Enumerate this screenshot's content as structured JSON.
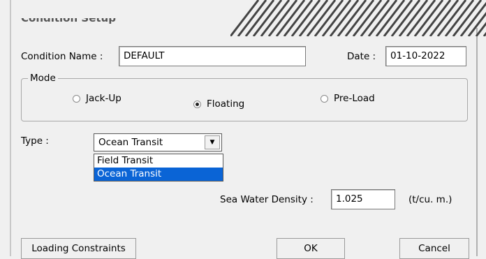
{
  "window": {
    "title": "Condition Setup"
  },
  "condition_name": {
    "label": "Condition Name :",
    "value": "DEFAULT"
  },
  "date": {
    "label": "Date :",
    "value": "01-10-2022"
  },
  "mode": {
    "legend": "Mode",
    "options": [
      {
        "label": "Jack-Up",
        "selected": false
      },
      {
        "label": "Floating",
        "selected": true
      },
      {
        "label": "Pre-Load",
        "selected": false
      }
    ]
  },
  "type": {
    "label": "Type :",
    "selected": "Ocean Transit",
    "options": [
      "Field Transit",
      "Ocean Transit"
    ],
    "highlighted": "Ocean Transit"
  },
  "density": {
    "label": "Sea Water Density :",
    "value": "1.025",
    "unit": "(t/cu. m.)"
  },
  "buttons": {
    "loading": "Loading Constraints",
    "ok": "OK",
    "cancel": "Cancel"
  },
  "colors": {
    "selection": "#0a64d6",
    "background": "#f0f0f0"
  }
}
